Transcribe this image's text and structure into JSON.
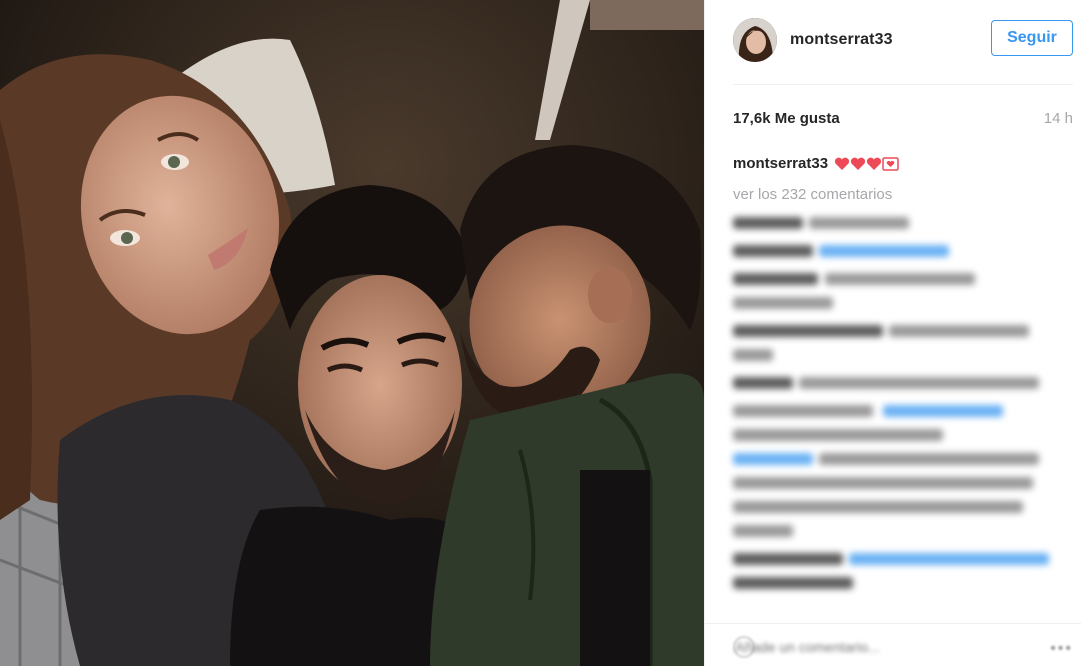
{
  "header": {
    "username": "montserrat33",
    "follow_label": "Seguir"
  },
  "stats": {
    "likes": "17,6k Me gusta",
    "time": "14 h"
  },
  "caption": {
    "username": "montserrat33",
    "emoji": [
      "heart-icon",
      "heart-icon",
      "heart-icon",
      "love-letter-icon"
    ]
  },
  "view_all": "ver los 232 comentarios",
  "comment_box": {
    "placeholder": "Añade un comentario..."
  },
  "icons": {
    "more": "more-options-icon"
  },
  "colors": {
    "accent": "#3897f0",
    "text": "#262626",
    "muted": "#a5a7aa",
    "heart": "#ed4956"
  }
}
